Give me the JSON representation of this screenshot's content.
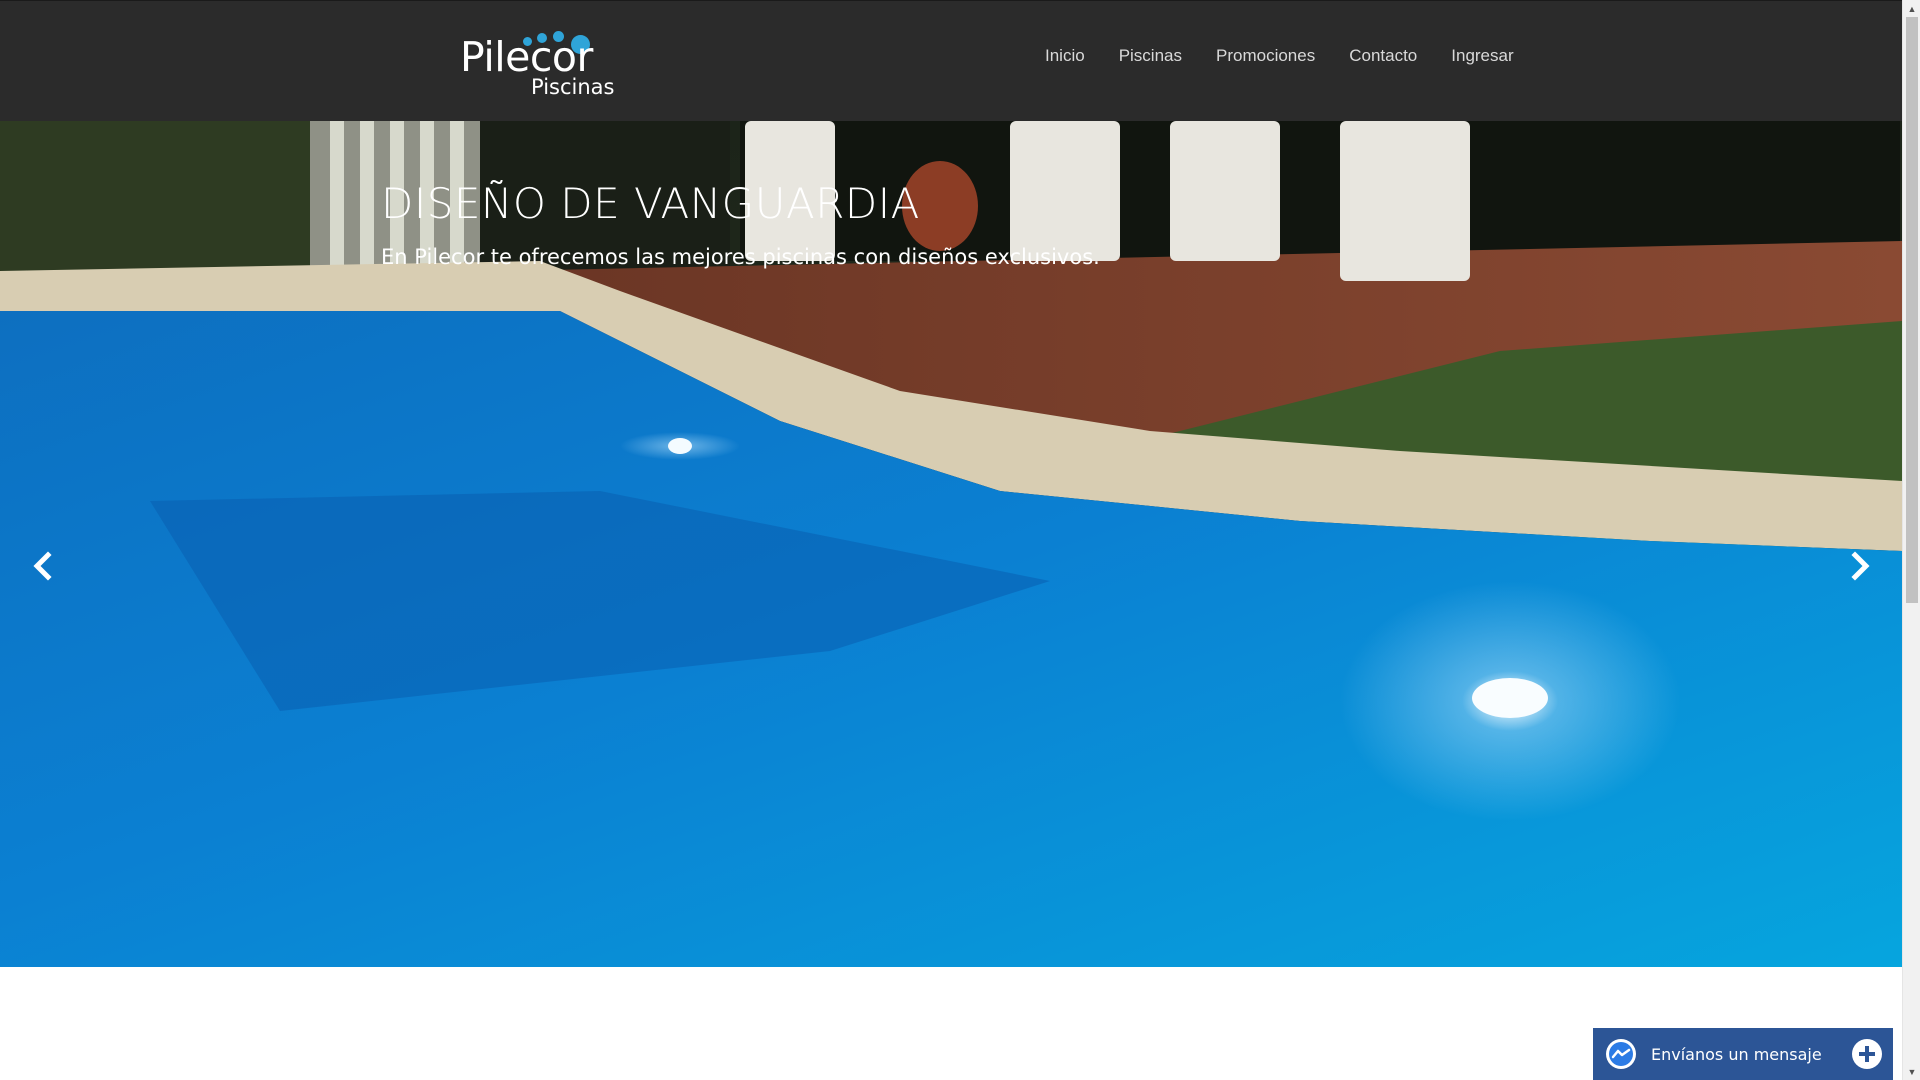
{
  "brand": {
    "name": "Pilecor",
    "sub": "Piscinas",
    "accent": "#2fa4d8"
  },
  "nav": {
    "items": [
      {
        "label": "Inicio"
      },
      {
        "label": "Piscinas"
      },
      {
        "label": "Promociones"
      },
      {
        "label": "Contacto"
      },
      {
        "label": "Ingresar"
      }
    ]
  },
  "hero": {
    "title": "DISEÑO DE VANGUARDIA",
    "subtitle": "En Pilecor te ofrecemos las mejores piscinas con diseños exclusivos.",
    "prev_icon": "chevron-left-icon",
    "next_icon": "chevron-right-icon"
  },
  "messenger": {
    "label": "Envíanos un mensaje",
    "icon": "messenger-icon",
    "expand_icon": "plus-icon",
    "color": "#2c5596"
  },
  "colors": {
    "header_bg": "#2b2b2b",
    "page_bg": "#ffffff"
  }
}
